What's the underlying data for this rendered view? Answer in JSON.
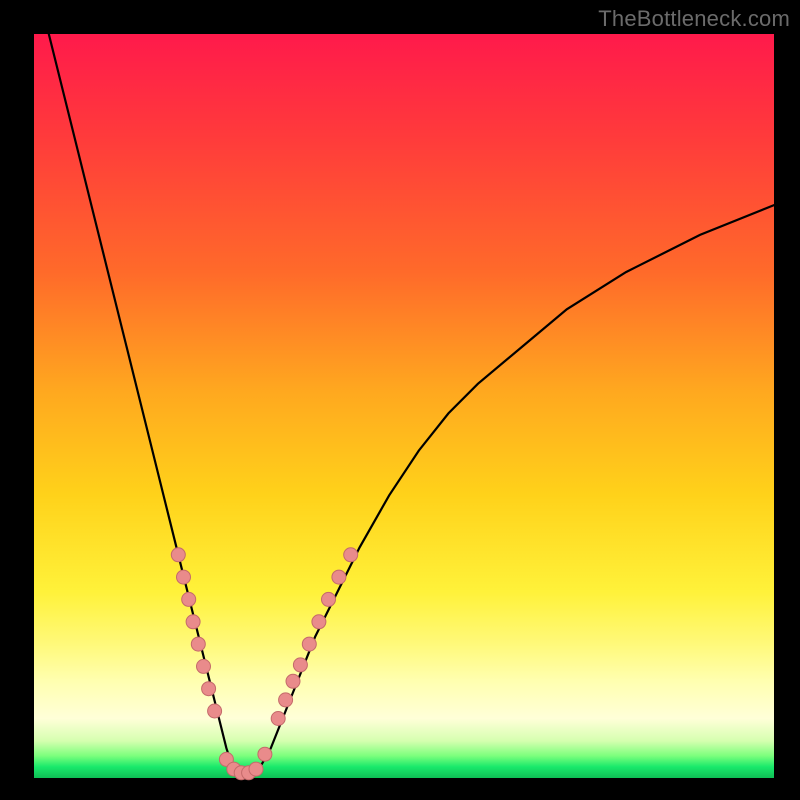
{
  "watermark": "TheBottleneck.com",
  "colors": {
    "curve_stroke": "#000000",
    "dot_fill": "#e98b8b",
    "dot_stroke": "#c46a6a"
  },
  "chart_data": {
    "type": "line",
    "title": "",
    "xlabel": "",
    "ylabel": "",
    "xlim": [
      0,
      100
    ],
    "ylim": [
      0,
      100
    ],
    "series": [
      {
        "name": "bottleneck-curve",
        "x": [
          2,
          4,
          6,
          8,
          10,
          12,
          14,
          16,
          18,
          20,
          21,
          22,
          23,
          24,
          25,
          26,
          27,
          28,
          29,
          30,
          32,
          34,
          36,
          38,
          40,
          44,
          48,
          52,
          56,
          60,
          66,
          72,
          80,
          90,
          100
        ],
        "y": [
          100,
          92,
          84,
          76,
          68,
          60,
          52,
          44,
          36,
          28,
          24,
          20,
          16,
          12,
          8,
          4,
          1,
          0,
          0,
          0.5,
          4,
          9,
          14,
          19,
          23,
          31,
          38,
          44,
          49,
          53,
          58,
          63,
          68,
          73,
          77
        ]
      }
    ],
    "dots": [
      {
        "x": 19.5,
        "y": 30
      },
      {
        "x": 20.2,
        "y": 27
      },
      {
        "x": 20.9,
        "y": 24
      },
      {
        "x": 21.5,
        "y": 21
      },
      {
        "x": 22.2,
        "y": 18
      },
      {
        "x": 22.9,
        "y": 15
      },
      {
        "x": 23.6,
        "y": 12
      },
      {
        "x": 24.4,
        "y": 9
      },
      {
        "x": 26.0,
        "y": 2.5
      },
      {
        "x": 27.0,
        "y": 1.2
      },
      {
        "x": 28.0,
        "y": 0.7
      },
      {
        "x": 29.0,
        "y": 0.7
      },
      {
        "x": 30.0,
        "y": 1.2
      },
      {
        "x": 31.2,
        "y": 3.2
      },
      {
        "x": 33.0,
        "y": 8
      },
      {
        "x": 34.0,
        "y": 10.5
      },
      {
        "x": 35.0,
        "y": 13
      },
      {
        "x": 36.0,
        "y": 15.2
      },
      {
        "x": 37.2,
        "y": 18
      },
      {
        "x": 38.5,
        "y": 21
      },
      {
        "x": 39.8,
        "y": 24
      },
      {
        "x": 41.2,
        "y": 27
      },
      {
        "x": 42.8,
        "y": 30
      }
    ]
  }
}
